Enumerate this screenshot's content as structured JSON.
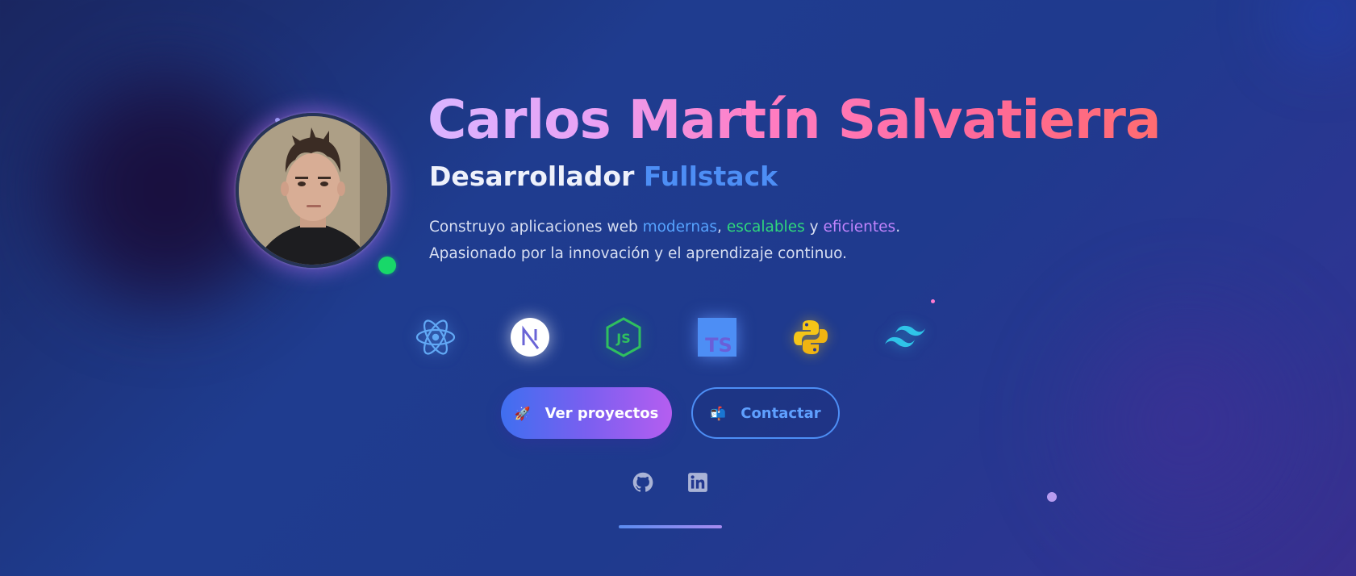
{
  "hero": {
    "name": "Carlos Martín Salvatierra",
    "role_prefix": "Desarrollador",
    "role_accent": "Fullstack",
    "description": {
      "part1": "Construyo aplicaciones web ",
      "hl1": "modernas",
      "sep1": ", ",
      "hl2": "escalables",
      "sep2": " y ",
      "hl3": "eficientes",
      "part2": ". Apasionado por la innovación y el aprendizaje continuo."
    }
  },
  "tech_icons": [
    {
      "icon": "react-icon",
      "color": "#61a8f5"
    },
    {
      "icon": "nextjs-icon",
      "color": "#ffffff"
    },
    {
      "icon": "nodejs-icon",
      "color": "#2fbf5f"
    },
    {
      "icon": "typescript-icon",
      "color": "#4d8ef5",
      "label": "TS"
    },
    {
      "icon": "python-icon",
      "color": "#f5c518"
    },
    {
      "icon": "tailwind-icon",
      "color": "#2fc4e8"
    }
  ],
  "buttons": {
    "primary": {
      "emoji": "🚀",
      "label": "Ver proyectos"
    },
    "secondary": {
      "emoji": "📬",
      "label": "Contactar"
    }
  },
  "socials": [
    {
      "icon": "github-icon"
    },
    {
      "icon": "linkedin-icon"
    }
  ],
  "colors": {
    "accent_blue": "#4d8ef5",
    "accent_green": "#2fd87c",
    "accent_purple": "#c084fc",
    "online": "#18d869"
  }
}
